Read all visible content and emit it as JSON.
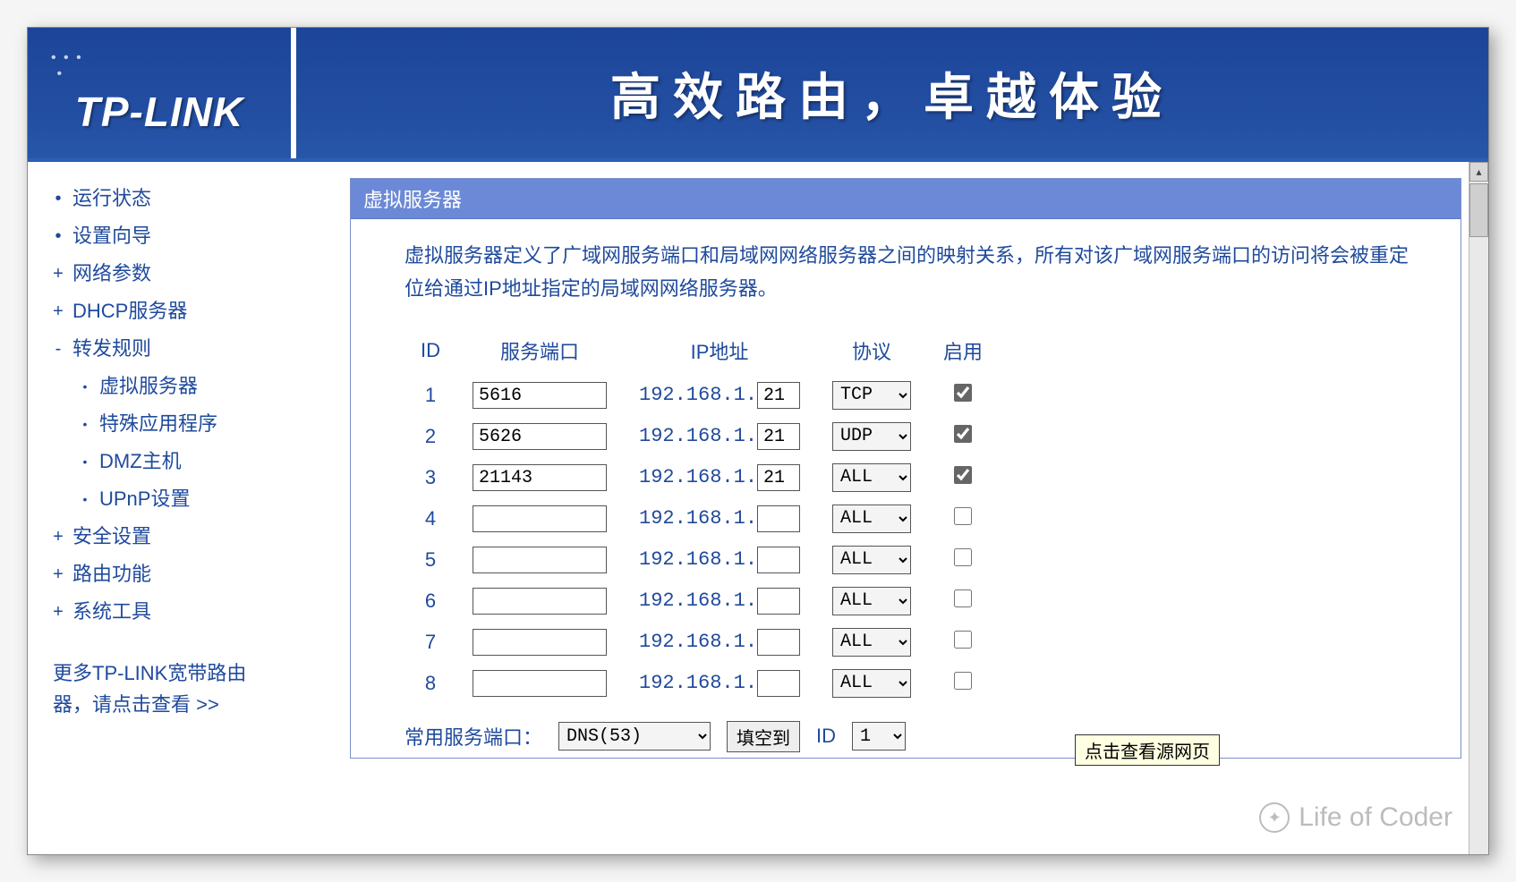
{
  "header": {
    "logo": "TP-LINK",
    "slogan": "高效路由，卓越体验"
  },
  "sidebar": {
    "items": [
      {
        "bullet": "•",
        "label": "运行状态",
        "sub": false
      },
      {
        "bullet": "•",
        "label": "设置向导",
        "sub": false
      },
      {
        "bullet": "+",
        "label": "网络参数",
        "sub": false
      },
      {
        "bullet": "+",
        "label": "DHCP服务器",
        "sub": false
      },
      {
        "bullet": "-",
        "label": "转发规则",
        "sub": false
      },
      {
        "bullet": "•",
        "label": "虚拟服务器",
        "sub": true
      },
      {
        "bullet": "•",
        "label": "特殊应用程序",
        "sub": true
      },
      {
        "bullet": "•",
        "label": "DMZ主机",
        "sub": true
      },
      {
        "bullet": "•",
        "label": "UPnP设置",
        "sub": true
      },
      {
        "bullet": "+",
        "label": "安全设置",
        "sub": false
      },
      {
        "bullet": "+",
        "label": "路由功能",
        "sub": false
      },
      {
        "bullet": "+",
        "label": "系统工具",
        "sub": false
      }
    ],
    "footer": "更多TP-LINK宽带路由器，请点击查看 >>"
  },
  "panel": {
    "title": "虚拟服务器",
    "description": "虚拟服务器定义了广域网服务端口和局域网网络服务器之间的映射关系，所有对该广域网服务端口的访问将会被重定位给通过IP地址指定的局域网网络服务器。",
    "columns": {
      "id": "ID",
      "port": "服务端口",
      "ip": "IP地址",
      "proto": "协议",
      "enable": "启用"
    },
    "ip_prefix": "192.168.1.",
    "rows": [
      {
        "id": "1",
        "port": "5616",
        "ip": "21",
        "proto": "TCP",
        "enabled": true
      },
      {
        "id": "2",
        "port": "5626",
        "ip": "21",
        "proto": "UDP",
        "enabled": true
      },
      {
        "id": "3",
        "port": "21143",
        "ip": "21",
        "proto": "ALL",
        "enabled": true
      },
      {
        "id": "4",
        "port": "",
        "ip": "",
        "proto": "ALL",
        "enabled": false
      },
      {
        "id": "5",
        "port": "",
        "ip": "",
        "proto": "ALL",
        "enabled": false
      },
      {
        "id": "6",
        "port": "",
        "ip": "",
        "proto": "ALL",
        "enabled": false
      },
      {
        "id": "7",
        "port": "",
        "ip": "",
        "proto": "ALL",
        "enabled": false
      },
      {
        "id": "8",
        "port": "",
        "ip": "",
        "proto": "ALL",
        "enabled": false
      }
    ],
    "bottom": {
      "label": "常用服务端口：",
      "service": "DNS(53)",
      "fill_btn": "填空到",
      "id_label": "ID",
      "id_value": "1"
    }
  },
  "tooltip": "点击查看源网页",
  "watermark": "Life of Coder"
}
